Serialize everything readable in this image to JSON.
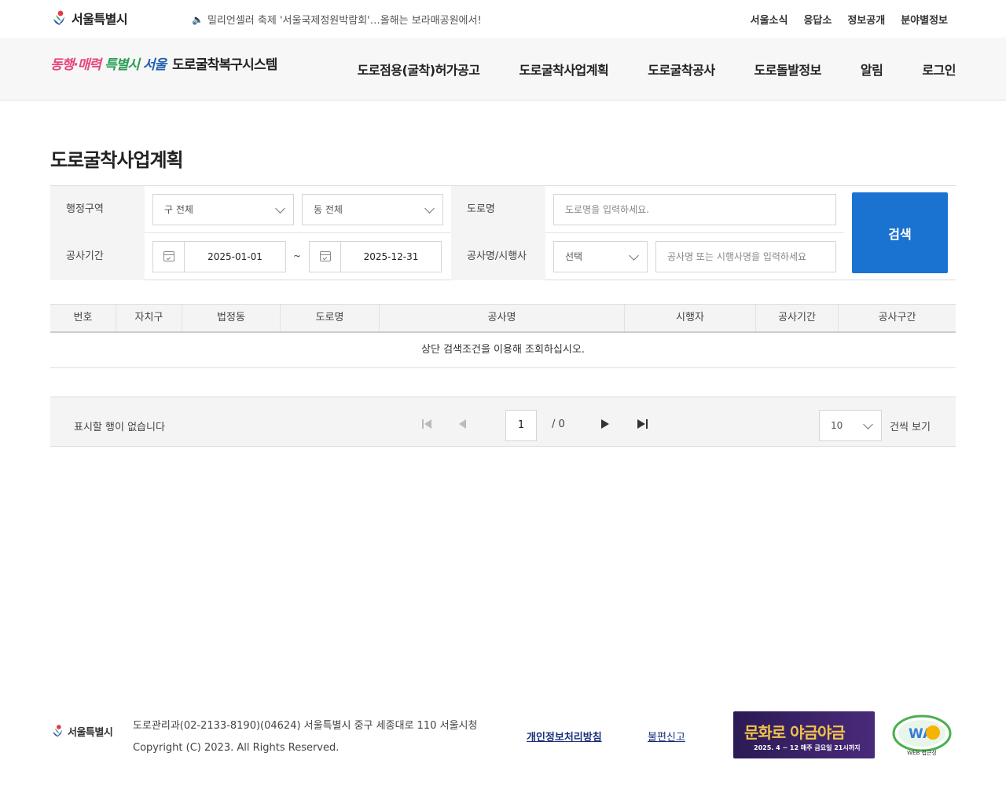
{
  "topbar": {
    "logo_text": "서울특별시",
    "notice": "밀리언셀러 축제 '서울국제정원박람회'…올해는 보라매공원에서!",
    "links": [
      "서울소식",
      "응답소",
      "정보공개",
      "분야별정보"
    ]
  },
  "navbar": {
    "slogan_1": "동행·매력",
    "slogan_2": "특별시",
    "slogan_3": "서울",
    "system_name": "도로굴착복구시스템",
    "menu": [
      "도로점용(굴착)허가공고",
      "도로굴착사업계획",
      "도로굴착공사",
      "도로돌발정보",
      "알림",
      "로그인"
    ]
  },
  "page": {
    "title": "도로굴착사업계획"
  },
  "search": {
    "region_label": "행정구역",
    "gu_value": "구 전체",
    "dong_value": "동 전체",
    "road_label": "도로명",
    "road_placeholder": "도로명을 입력하세요.",
    "period_label": "공사기간",
    "date_from": "2025-01-01",
    "tilde": "~",
    "date_to": "2025-12-31",
    "name_label": "공사명/시행사",
    "name_select": "선택",
    "name_placeholder": "공사명 또는 시행사명을 입력하세요",
    "button": "검색"
  },
  "grid": {
    "columns": [
      "번호",
      "자치구",
      "법정동",
      "도로명",
      "공사명",
      "시행자",
      "공사기간",
      "공사구간"
    ],
    "empty_message": "상단 검색조건을 이용해 조회하십시오."
  },
  "pager": {
    "info": "표시할 행이 없습니다",
    "current_page": "1",
    "total_pages": "/ 0",
    "page_size": "10",
    "page_size_unit": "건씩 보기"
  },
  "footer": {
    "logo_text": "서울특별시",
    "address": "도로관리과(02-2133-8190)(04624) 서울특별시 중구 세종대로 110 서울시청",
    "copyright": "Copyright (C) 2023. All Rights Reserved.",
    "privacy_link": "개인정보처리방침",
    "report_link": "불편신고",
    "banner_title": "문화로 야금야금",
    "banner_sub": "2025. 4 ~ 12 매주 금요일 21시까지",
    "wa_mark": "WA",
    "wa_caption": "WEB 접근성"
  },
  "colors": {
    "accent": "#1a73d0",
    "header_bg": "#f7f7f7",
    "label_bg": "#f4f4f4"
  }
}
